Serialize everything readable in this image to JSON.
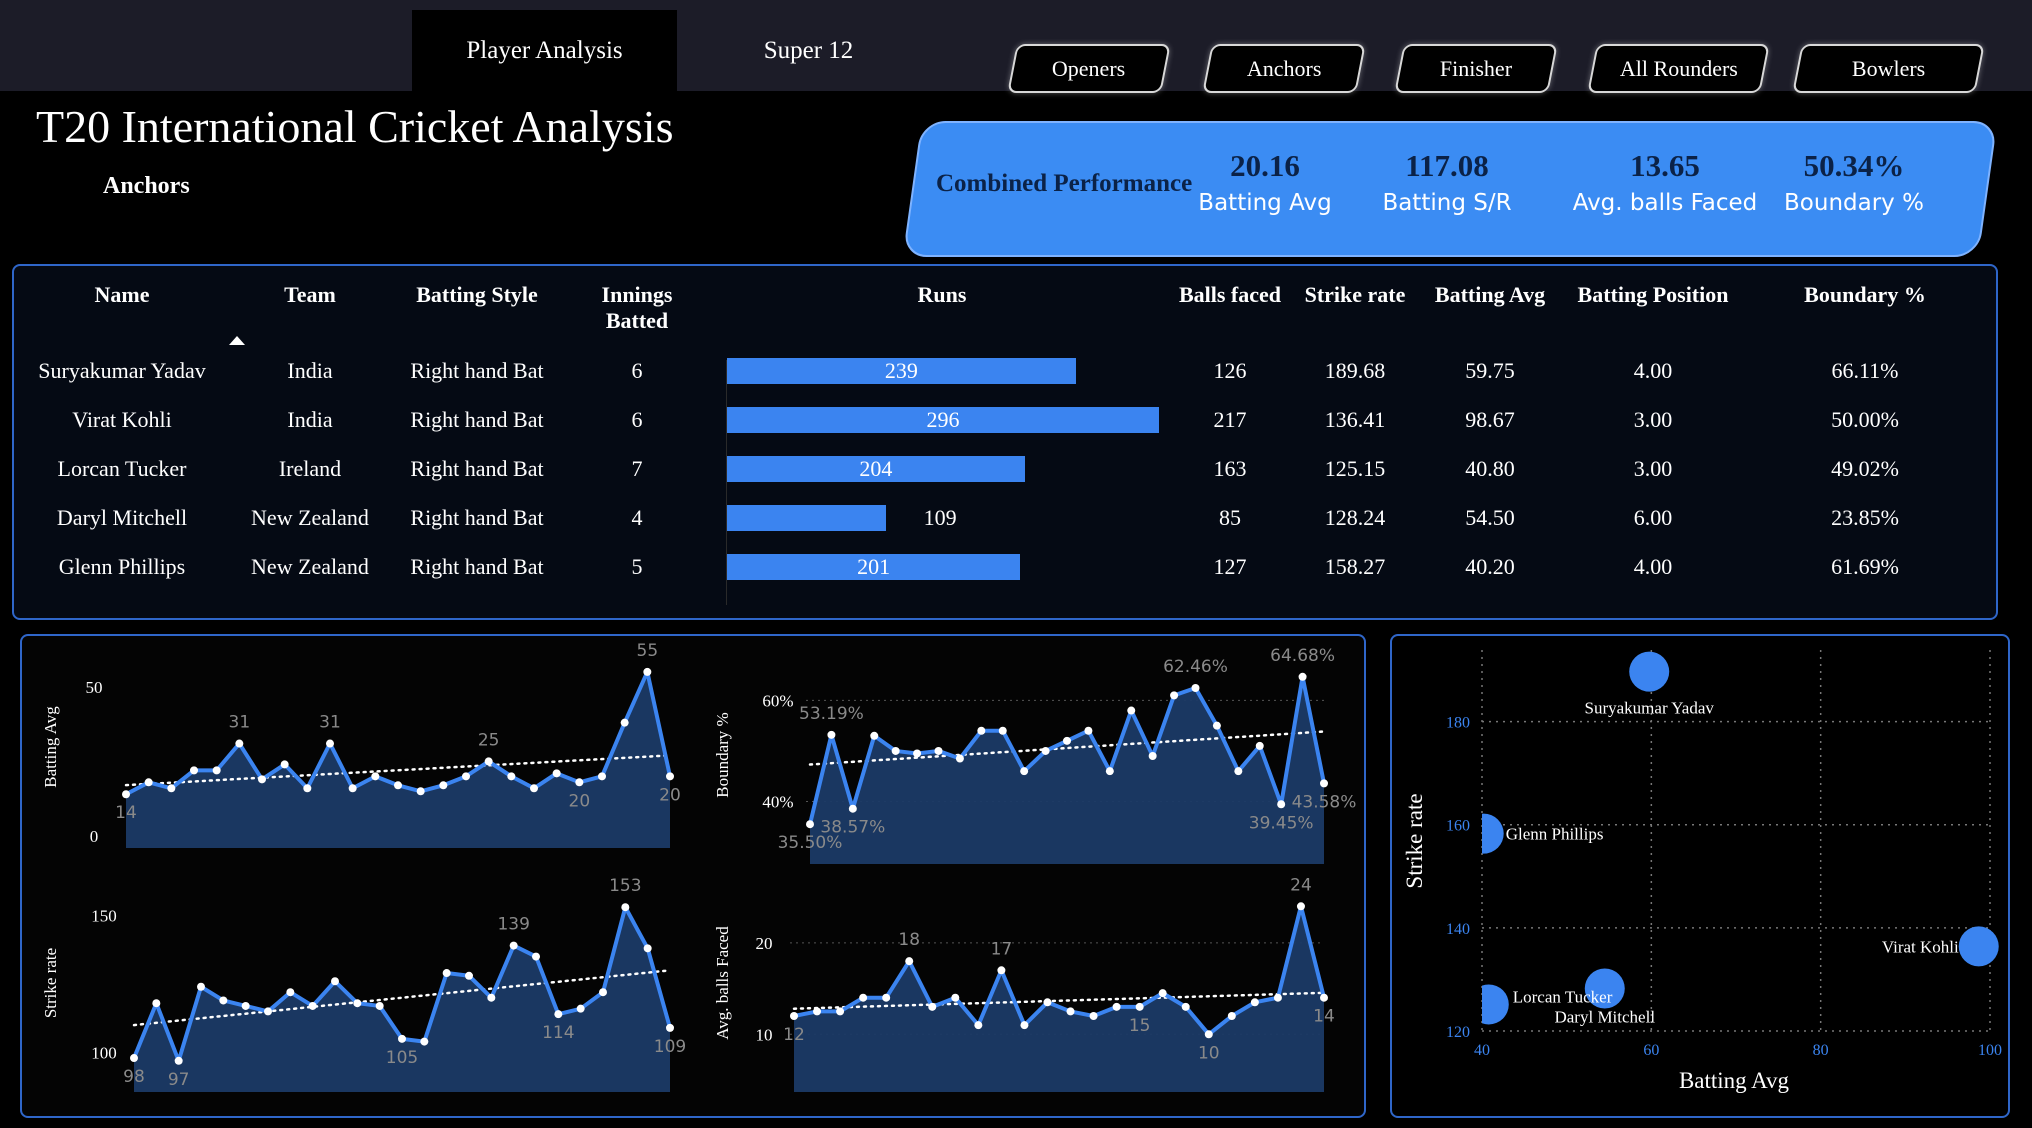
{
  "tabs": [
    {
      "label": "Player Analysis",
      "active": true
    },
    {
      "label": "Super 12",
      "active": false
    }
  ],
  "segments": [
    "Openers",
    "Anchors",
    "Finisher",
    "All Rounders",
    "Bowlers"
  ],
  "title": "T20 International Cricket Analysis",
  "subtitle": "Anchors",
  "kpis": {
    "heading": "Combined Performance",
    "items": [
      {
        "value": "20.16",
        "label": "Batting Avg"
      },
      {
        "value": "117.08",
        "label": "Batting S/R"
      },
      {
        "value": "13.65",
        "label": "Avg. balls Faced"
      },
      {
        "value": "50.34%",
        "label": "Boundary %"
      }
    ]
  },
  "table": {
    "headers": {
      "name": "Name",
      "team": "Team",
      "style": "Batting Style",
      "innings_1": "Innings",
      "innings_2": "Batted",
      "runs": "Runs",
      "balls": "Balls faced",
      "sr": "Strike rate",
      "avg": "Batting Avg",
      "pos": "Batting Position",
      "boundary": "Boundary %"
    },
    "sort": {
      "column": "Name",
      "direction": "ascending"
    },
    "runs_max": 296,
    "rows": [
      {
        "name": "Suryakumar Yadav",
        "team": "India",
        "style": "Right hand Bat",
        "innings": "6",
        "runs": 239,
        "runs_label": "239",
        "balls": "126",
        "sr": "189.68",
        "avg": "59.75",
        "pos": "4.00",
        "boundary": "66.11%"
      },
      {
        "name": "Virat Kohli",
        "team": "India",
        "style": "Right hand Bat",
        "innings": "6",
        "runs": 296,
        "runs_label": "296",
        "balls": "217",
        "sr": "136.41",
        "avg": "98.67",
        "pos": "3.00",
        "boundary": "50.00%"
      },
      {
        "name": "Lorcan Tucker",
        "team": "Ireland",
        "style": "Right hand Bat",
        "innings": "7",
        "runs": 204,
        "runs_label": "204",
        "balls": "163",
        "sr": "125.15",
        "avg": "40.80",
        "pos": "3.00",
        "boundary": "49.02%"
      },
      {
        "name": "Daryl Mitchell",
        "team": "New Zealand",
        "style": "Right hand Bat",
        "innings": "4",
        "runs": 109,
        "runs_label": "109",
        "balls": "85",
        "sr": "128.24",
        "avg": "54.50",
        "pos": "6.00",
        "boundary": "23.85%"
      },
      {
        "name": "Glenn Phillips",
        "team": "New Zealand",
        "style": "Right hand Bat",
        "innings": "5",
        "runs": 201,
        "runs_label": "201",
        "balls": "127",
        "sr": "158.27",
        "avg": "40.20",
        "pos": "4.00",
        "boundary": "61.69%"
      }
    ]
  },
  "colors": {
    "accent": "#3b84f0",
    "area": "#1b3a66",
    "line": "#3b84f0",
    "kpi_text": "#0b2247"
  },
  "chart_data": [
    {
      "type": "area",
      "ylabel": "Batting Avg",
      "xlabel": "",
      "ylim": [
        0,
        59
      ],
      "yticks": [
        0,
        50
      ],
      "trendline": true,
      "values": [
        14,
        18,
        16,
        22,
        22,
        31,
        19,
        24,
        16,
        31,
        16,
        20,
        17,
        15,
        17,
        20,
        25,
        20,
        16,
        21,
        18,
        20,
        38,
        55,
        20
      ],
      "labels": [
        {
          "i": 0,
          "text": "14"
        },
        {
          "i": 5,
          "text": "31"
        },
        {
          "i": 9,
          "text": "31"
        },
        {
          "i": 16,
          "text": "25"
        },
        {
          "i": 20,
          "text": "20"
        },
        {
          "i": 23,
          "text": "55"
        },
        {
          "i": 24,
          "text": "20"
        }
      ]
    },
    {
      "type": "area",
      "ylabel": "Boundary %",
      "xlabel": "",
      "yticks": [
        40,
        60
      ],
      "ytick_labels": [
        "40%",
        "60%"
      ],
      "ylim": [
        30,
        68
      ],
      "trendline": true,
      "values": [
        35.5,
        53.19,
        38.57,
        53,
        50,
        49.5,
        50,
        48.5,
        54,
        54,
        46,
        50,
        52,
        54,
        46,
        58,
        49,
        61,
        62.46,
        55,
        46,
        51,
        39.45,
        64.68,
        43.58
      ],
      "labels": [
        {
          "i": 0,
          "text": "35.50%"
        },
        {
          "i": 1,
          "text": "53.19%"
        },
        {
          "i": 2,
          "text": "38.57%"
        },
        {
          "i": 18,
          "text": "62.46%"
        },
        {
          "i": 22,
          "text": "39.45%"
        },
        {
          "i": 23,
          "text": "64.68%"
        },
        {
          "i": 24,
          "text": "43.58%"
        }
      ]
    },
    {
      "type": "area",
      "ylabel": "Strike rate",
      "xlabel": "",
      "yticks": [
        100,
        150
      ],
      "ylim": [
        90,
        160
      ],
      "trendline": true,
      "values": [
        98,
        118,
        97,
        124,
        119,
        117,
        115,
        122,
        117,
        126,
        118,
        117,
        105,
        104,
        129,
        128,
        120,
        139,
        135,
        114,
        116,
        122,
        153,
        138,
        109
      ],
      "labels": [
        {
          "i": 0,
          "text": "98"
        },
        {
          "i": 2,
          "text": "97"
        },
        {
          "i": 12,
          "text": "105"
        },
        {
          "i": 17,
          "text": "139"
        },
        {
          "i": 19,
          "text": "114"
        },
        {
          "i": 22,
          "text": "153"
        },
        {
          "i": 24,
          "text": "109"
        }
      ]
    },
    {
      "type": "area",
      "ylabel": "Avg. balls Faced",
      "xlabel": "",
      "yticks": [
        10,
        20
      ],
      "ylim": [
        5,
        26
      ],
      "trendline": true,
      "values": [
        12,
        12.5,
        12.5,
        14,
        14,
        18,
        13,
        14,
        11,
        17,
        11,
        13.5,
        12.5,
        12,
        13,
        13,
        14.5,
        13,
        10,
        12,
        13.5,
        14,
        24,
        14
      ],
      "labels": [
        {
          "i": 0,
          "text": "12"
        },
        {
          "i": 5,
          "text": "18"
        },
        {
          "i": 9,
          "text": "17"
        },
        {
          "i": 15,
          "text": "15"
        },
        {
          "i": 18,
          "text": "10"
        },
        {
          "i": 22,
          "text": "24"
        },
        {
          "i": 23,
          "text": "14"
        }
      ]
    },
    {
      "type": "scatter",
      "xlabel": "Batting Avg",
      "ylabel": "Strike rate",
      "xlim": [
        40,
        100
      ],
      "ylim": [
        120,
        190
      ],
      "xticks": [
        40,
        60,
        80,
        100
      ],
      "yticks": [
        120,
        140,
        160,
        180
      ],
      "points": [
        {
          "name": "Suryakumar Yadav",
          "x": 59.75,
          "y": 189.68
        },
        {
          "name": "Glenn Phillips",
          "x": 40.2,
          "y": 158.27
        },
        {
          "name": "Virat Kohli",
          "x": 98.67,
          "y": 136.41
        },
        {
          "name": "Lorcan Tucker",
          "x": 40.8,
          "y": 125.15
        },
        {
          "name": "Daryl Mitchell",
          "x": 54.5,
          "y": 128.24
        }
      ]
    }
  ]
}
